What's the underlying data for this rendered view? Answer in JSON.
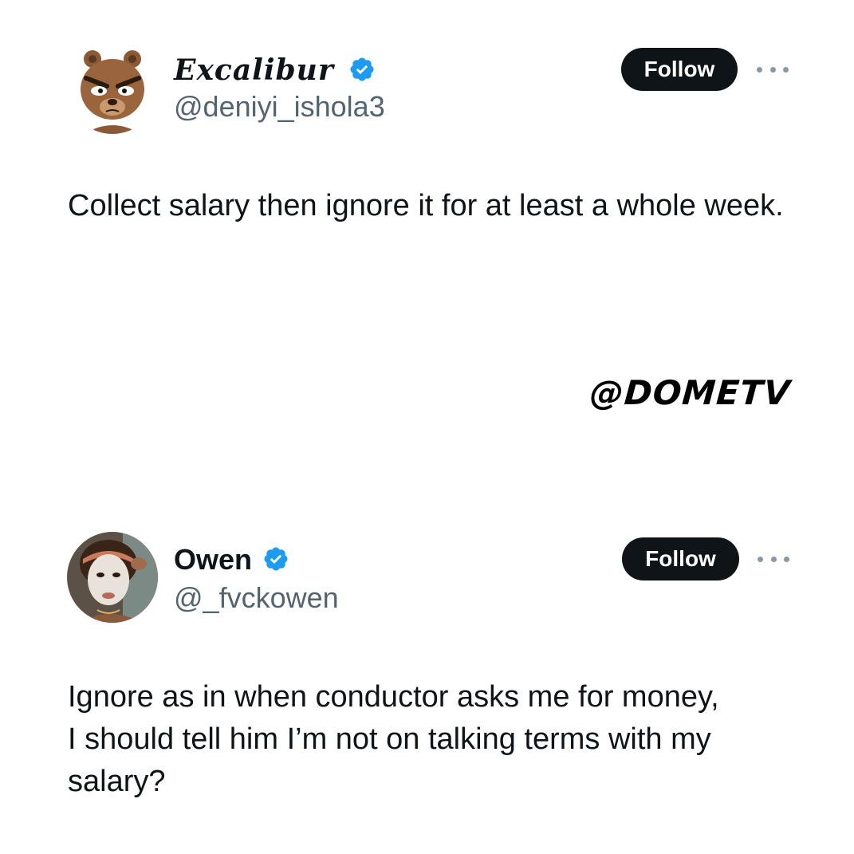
{
  "tweets": [
    {
      "author": {
        "display_name": "Excalibur",
        "handle": "@deniyi_ishola3",
        "verified": true,
        "avatar": "cartoon-bear-avatar"
      },
      "follow_label": "Follow",
      "more_icon": "more-dots-icon",
      "text": "Collect salary then ignore it for at least a whole week."
    },
    {
      "author": {
        "display_name": "Owen",
        "handle": "@_fvckowen",
        "verified": true,
        "avatar": "face-mask-photo-avatar"
      },
      "follow_label": "Follow",
      "more_icon": "more-dots-icon",
      "text": "Ignore as in when conductor asks me for money, I should tell him I’m not on talking terms with my salary?"
    }
  ],
  "watermark": "@DOMETV",
  "colors": {
    "verified_blue": "#1d9bf0",
    "text_primary": "#0f1419",
    "text_secondary": "#536471",
    "button_bg": "#0f1419",
    "button_text": "#ffffff"
  }
}
